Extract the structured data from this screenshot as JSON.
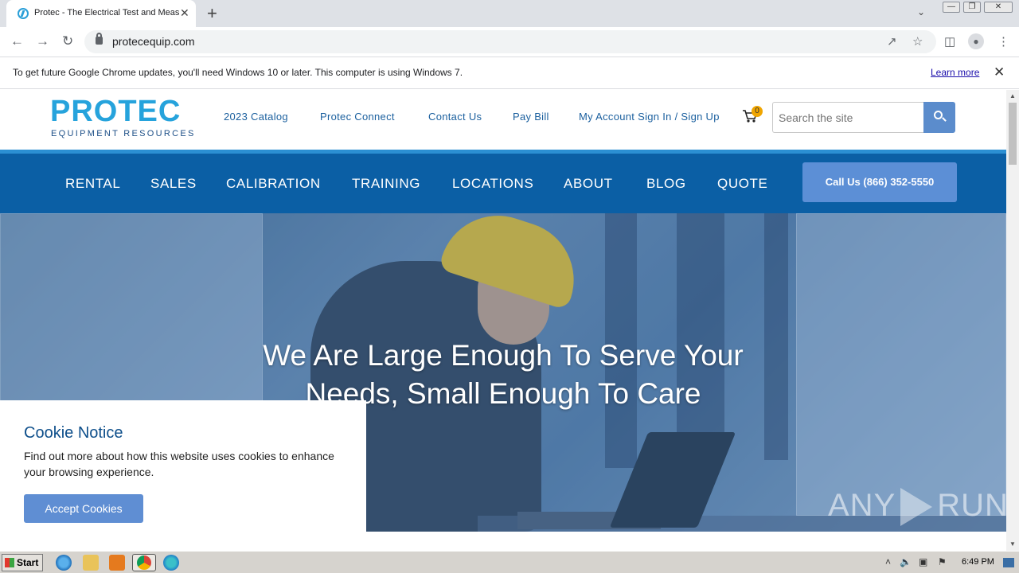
{
  "browser": {
    "tab_title": "Protec - The Electrical Test and Measurement",
    "tab_close": "✕",
    "new_tab": "+",
    "url": "protecequip.com",
    "infobar_message": "To get future Google Chrome updates, you'll need Windows 10 or later. This computer is using Windows 7.",
    "infobar_link": "Learn more",
    "infobar_close": "✕"
  },
  "header": {
    "logo_main": "PROTEC",
    "logo_sub": "EQUIPMENT RESOURCES",
    "links": [
      "2023 Catalog",
      "Protec Connect",
      "Contact Us",
      "Pay Bill",
      "My Account Sign In / Sign Up"
    ],
    "cart_count": "0",
    "search_placeholder": "Search the site"
  },
  "nav": {
    "items": [
      "RENTAL",
      "SALES",
      "CALIBRATION",
      "TRAINING",
      "LOCATIONS",
      "ABOUT",
      "BLOG",
      "QUOTE"
    ],
    "call_button": "Call Us (866) 352-5550"
  },
  "hero": {
    "headline": "We Are Large Enough To Serve Your Needs, Small Enough To Care"
  },
  "cookie": {
    "title": "Cookie Notice",
    "text": "Find out more about how this website uses cookies to enhance your browsing experience.",
    "button": "Accept Cookies"
  },
  "watermark": {
    "left": "ANY",
    "right": "RUN"
  },
  "taskbar": {
    "start": "Start",
    "clock": "6:49 PM"
  },
  "colors": {
    "nav_blue": "#0b5fa5",
    "accent_blue": "#5c8fd6",
    "logo_blue": "#26a3dc"
  }
}
